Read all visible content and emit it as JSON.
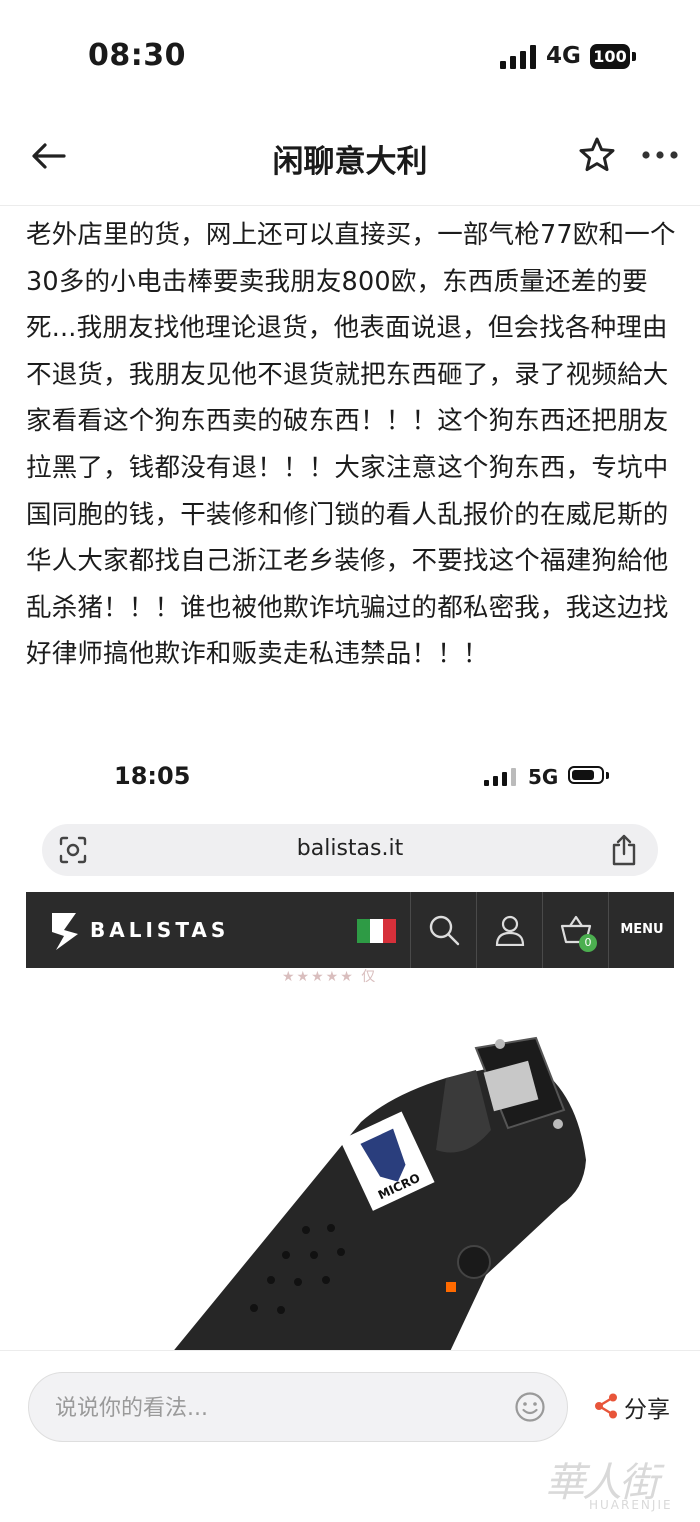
{
  "status_bar": {
    "time": "08:30",
    "network": "4G",
    "battery": "100"
  },
  "nav": {
    "title": "闲聊意大利"
  },
  "post": {
    "text": "老外店里的货，网上还可以直接买，一部气枪77欧和一个30多的小电击棒要卖我朋友800欧，东西质量还差的要死...我朋友找他理论退货，他表面说退，但会找各种理由不退货，我朋友见他不退货就把东西砸了，录了视频給大家看看这个狗东西卖的破东西！！！这个狗东西还把朋友拉黑了，钱都没有退！！！大家注意这个狗东西，专坑中国同胞的钱，干装修和修门锁的看人乱报价的在威尼斯的华人大家都找自己浙江老乡装修，不要找这个福建狗給他乱杀猪！！！谁也被他欺诈坑骗过的都私密我，我这边找好律师搞他欺诈和贩卖走私违禁品！！！"
  },
  "embedded_screenshot": {
    "time": "18:05",
    "network": "5G",
    "url": "balistas.it",
    "brand": "BALISTAS",
    "menu_label": "MENU",
    "cart_count": "0",
    "stars_fragment": "★★★★★ 仅",
    "product_label": "MICRO"
  },
  "bottom_bar": {
    "comment_placeholder": "说说你的看法...",
    "share_label": "分享"
  },
  "watermark": {
    "main": "華人街",
    "sub": "HUARENJIE"
  },
  "colors": {
    "accent_share": "#e8553a",
    "site_header": "#2b2b2b"
  }
}
